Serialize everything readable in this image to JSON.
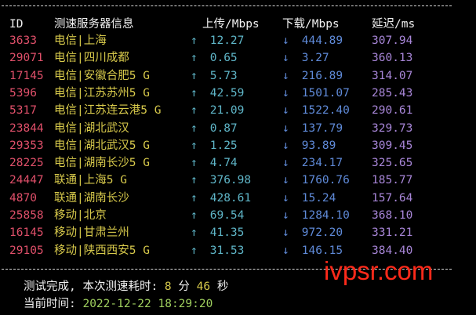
{
  "header": {
    "id": "ID",
    "loc": "测速服务器信息",
    "up": "上传/Mbps",
    "down": "下载/Mbps",
    "latency": "延迟/ms"
  },
  "arrows": {
    "up": "↑",
    "down": "↓"
  },
  "rows": [
    {
      "id": "3633",
      "loc": "电信|上海",
      "up": "12.27",
      "down": "444.89",
      "lat": "307.94"
    },
    {
      "id": "29071",
      "loc": "电信|四川成都",
      "up": "0.65",
      "down": "3.27",
      "lat": "360.13"
    },
    {
      "id": "17145",
      "loc": "电信|安徽合肥5 G",
      "up": "5.73",
      "down": "216.89",
      "lat": "314.07"
    },
    {
      "id": "5396",
      "loc": "电信|江苏苏州5 G",
      "up": "42.59",
      "down": "1501.07",
      "lat": "285.43"
    },
    {
      "id": "5317",
      "loc": "电信|江苏连云港5 G",
      "up": "21.09",
      "down": "1522.40",
      "lat": "290.61"
    },
    {
      "id": "23844",
      "loc": "电信|湖北武汉",
      "up": "0.87",
      "down": "137.79",
      "lat": "329.73"
    },
    {
      "id": "29353",
      "loc": "电信|湖北武汉5 G",
      "up": "1.25",
      "down": "93.89",
      "lat": "309.45"
    },
    {
      "id": "28225",
      "loc": "电信|湖南长沙5 G",
      "up": "4.74",
      "down": "234.17",
      "lat": "325.65"
    },
    {
      "id": "24447",
      "loc": "联通|上海5 G",
      "up": "376.98",
      "down": "1760.76",
      "lat": "185.77"
    },
    {
      "id": "4870",
      "loc": "联通|湖南长沙",
      "up": "428.61",
      "down": "15.24",
      "lat": "157.64"
    },
    {
      "id": "25858",
      "loc": "移动|北京",
      "up": "69.54",
      "down": "1284.10",
      "lat": "368.10"
    },
    {
      "id": "16145",
      "loc": "移动|甘肃兰州",
      "up": "41.35",
      "down": "972.20",
      "lat": "331.21"
    },
    {
      "id": "29105",
      "loc": "移动|陕西西安5 G",
      "up": "31.53",
      "down": "146.15",
      "lat": "384.40"
    }
  ],
  "summary": {
    "done_prefix": "测试完成, 本次测速耗时: ",
    "minutes": "8",
    "min_unit": " 分 ",
    "seconds": "46",
    "sec_unit": " 秒",
    "time_label": "当前时间: ",
    "time_value": "2022-12-22 18:29:20"
  },
  "watermark": "ivpsr.com"
}
